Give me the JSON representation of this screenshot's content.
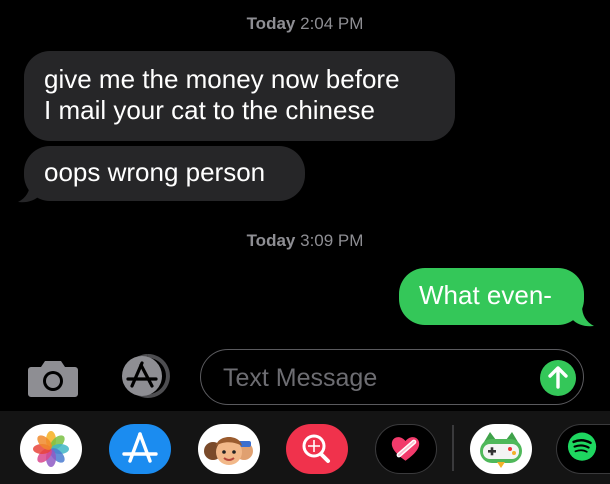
{
  "timestamps": [
    {
      "day": "Today",
      "time": "2:04 PM"
    },
    {
      "day": "Today",
      "time": "3:09 PM"
    }
  ],
  "messages": [
    {
      "direction": "incoming",
      "text": "give me the money now before\nI mail your cat to the chinese"
    },
    {
      "direction": "incoming",
      "text": "oops wrong person"
    },
    {
      "direction": "outgoing",
      "text": "What even-"
    }
  ],
  "input": {
    "placeholder": "Text Message"
  },
  "input_icons": {
    "camera": "camera-icon",
    "apps": "app-store-icon",
    "send": "arrow-up-icon"
  },
  "app_drawer": [
    {
      "name": "photos-icon"
    },
    {
      "name": "app-store-icon"
    },
    {
      "name": "memoji-icon"
    },
    {
      "name": "image-search-icon"
    },
    {
      "name": "digital-touch-icon"
    },
    {
      "name": "game-controller-icon"
    },
    {
      "name": "spotify-icon"
    }
  ],
  "colors": {
    "background": "#000000",
    "incoming_bubble": "#262628",
    "outgoing_bubble": "#34c759",
    "timestamp": "#8e8e93",
    "drawer": "#141414"
  }
}
